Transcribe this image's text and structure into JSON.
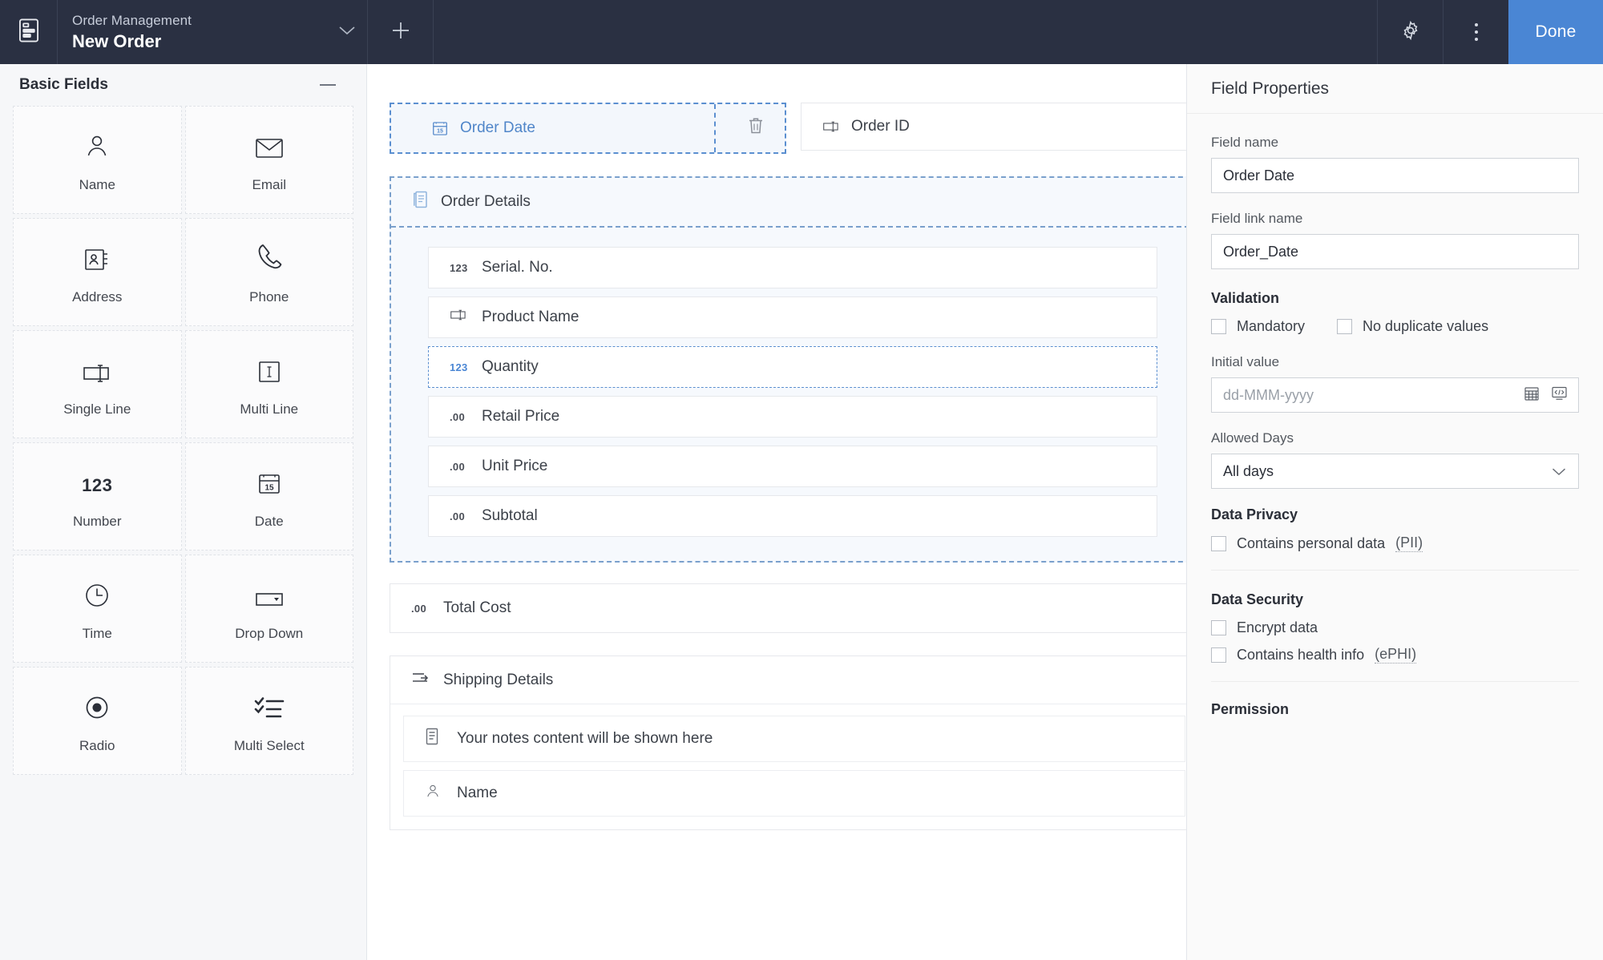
{
  "topbar": {
    "logo_icon": "form-document-icon",
    "app_name": "Order Management",
    "form_name": "New Order",
    "chevron_icon": "chevron-down-icon",
    "add_icon": "plus-icon",
    "settings_icon": "gear-icon",
    "more_icon": "kebab-menu-icon",
    "done_label": "Done",
    "accent_color": "#4a86d4",
    "bar_color": "#2a3042"
  },
  "palette": {
    "title": "Basic Fields",
    "collapse_icon": "minus-icon",
    "items": [
      {
        "label": "Name",
        "icon": "user-icon"
      },
      {
        "label": "Email",
        "icon": "envelope-icon"
      },
      {
        "label": "Address",
        "icon": "address-book-icon"
      },
      {
        "label": "Phone",
        "icon": "phone-icon"
      },
      {
        "label": "Single Line",
        "icon": "single-line-text-icon"
      },
      {
        "label": "Multi Line",
        "icon": "multi-line-text-icon"
      },
      {
        "label": "Number",
        "icon": "number-123-icon"
      },
      {
        "label": "Date",
        "icon": "calendar-15-icon"
      },
      {
        "label": "Time",
        "icon": "clock-icon"
      },
      {
        "label": "Drop Down",
        "icon": "dropdown-icon"
      },
      {
        "label": "Radio",
        "icon": "radio-button-icon"
      },
      {
        "label": "Multi Select",
        "icon": "multi-select-icon"
      }
    ]
  },
  "canvas": {
    "order_date": {
      "label": "Order Date",
      "icon": "calendar-15-icon",
      "state": "selected",
      "delete_icon": "trash-icon"
    },
    "order_id": {
      "label": "Order ID",
      "icon": "single-line-text-icon"
    },
    "subform": {
      "title": "Order Details",
      "icon": "subform-list-icon",
      "fields": [
        {
          "label": "Serial. No.",
          "icon": "number-123-icon",
          "glyph": "123",
          "state": "normal"
        },
        {
          "label": "Product Name",
          "icon": "single-line-text-icon",
          "glyph": "",
          "state": "normal"
        },
        {
          "label": "Quantity",
          "icon": "number-123-icon",
          "glyph": "123",
          "state": "hovered"
        },
        {
          "label": "Retail Price",
          "icon": "decimal-icon",
          "glyph": ".00",
          "state": "normal"
        },
        {
          "label": "Unit Price",
          "icon": "decimal-icon",
          "glyph": ".00",
          "state": "normal"
        },
        {
          "label": "Subtotal",
          "icon": "decimal-icon",
          "glyph": ".00",
          "state": "normal"
        }
      ]
    },
    "total_cost": {
      "label": "Total Cost",
      "icon": "decimal-icon",
      "glyph": ".00"
    },
    "shipping": {
      "title": "Shipping Details",
      "icon": "arrow-into-line-icon",
      "fields": [
        {
          "label": "Your notes content will be shown here",
          "icon": "notes-icon"
        },
        {
          "label": "Name",
          "icon": "user-icon"
        }
      ]
    }
  },
  "properties": {
    "panel_title": "Field Properties",
    "field_name_label": "Field name",
    "field_name_value": "Order Date",
    "field_link_label": "Field link name",
    "field_link_value": "Order_Date",
    "validation_title": "Validation",
    "mandatory_label": "Mandatory",
    "mandatory_checked": false,
    "no_duplicate_label": "No duplicate values",
    "no_duplicate_checked": false,
    "initial_value_label": "Initial value",
    "initial_value_placeholder": "dd-MMM-yyyy",
    "initial_value_value": "",
    "calendar_icon": "calendar-picker-icon",
    "formula_icon": "code-formula-icon",
    "allowed_days_label": "Allowed Days",
    "allowed_days_value": "All days",
    "allowed_days_chevron": "chevron-down-icon",
    "data_privacy_title": "Data Privacy",
    "pii_label": "Contains personal data",
    "pii_abbr": "(PII)",
    "pii_checked": false,
    "data_security_title": "Data Security",
    "encrypt_label": "Encrypt data",
    "encrypt_checked": false,
    "ephi_label": "Contains health info",
    "ephi_abbr": "(ePHI)",
    "ephi_checked": false,
    "permission_title": "Permission"
  }
}
